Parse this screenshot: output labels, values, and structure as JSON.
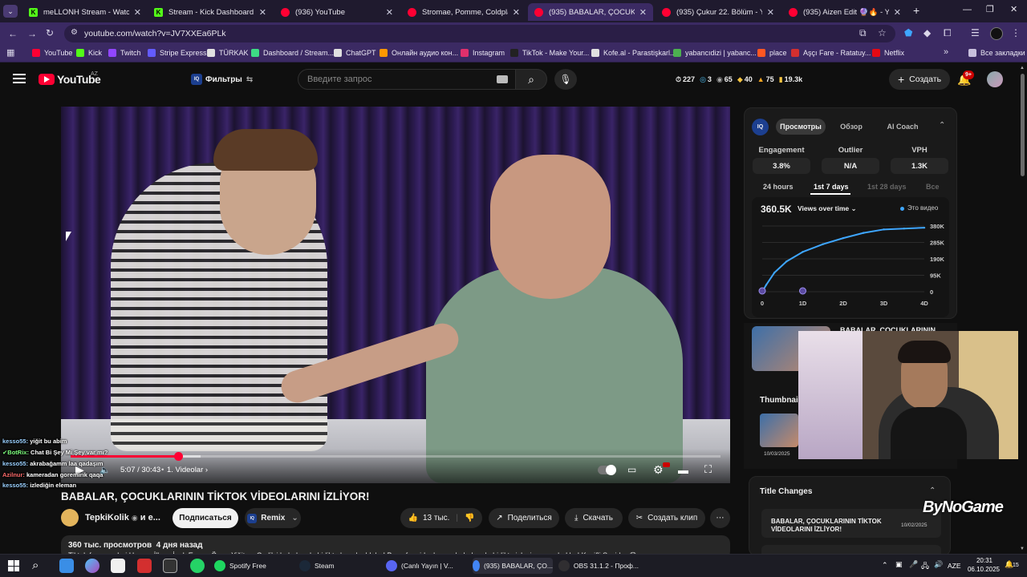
{
  "browser": {
    "tabs": [
      {
        "title": "meLLONH Stream - Watch Live",
        "icon": "kick-icon"
      },
      {
        "title": "Stream - Kick Dashboard",
        "icon": "kick-icon"
      },
      {
        "title": "(936) YouTube",
        "icon": "youtube-icon"
      },
      {
        "title": "Stromae, Pomme, Coldplay - \"M",
        "icon": "youtube-icon"
      },
      {
        "title": "(935) BABALAR, ÇOCUKLARINI",
        "icon": "youtube-icon",
        "active": true
      },
      {
        "title": "(935) Çukur 22. Bölüm - YouTub",
        "icon": "youtube-icon"
      },
      {
        "title": "(935) Aizen Edit 🔮🔥 - YouTub",
        "icon": "youtube-icon"
      }
    ],
    "url": "youtube.com/watch?v=JV7XXEa6PLk",
    "bookmarks": [
      {
        "label": "YouTube",
        "color": "#ff0033"
      },
      {
        "label": "Kick",
        "color": "#53fc18"
      },
      {
        "label": "Twitch",
        "color": "#9146ff"
      },
      {
        "label": "Stripe Express",
        "color": "#635bff"
      },
      {
        "label": "TÜRKAK",
        "color": "#e0e0e0"
      },
      {
        "label": "Dashboard / Stream...",
        "color": "#3ddc84"
      },
      {
        "label": "ChatGPT",
        "color": "#e0e0e0"
      },
      {
        "label": "Онлайн аудио кон...",
        "color": "#ff9800"
      },
      {
        "label": "Instagram",
        "color": "#e1306c"
      },
      {
        "label": "TikTok - Make Your...",
        "color": "#222222"
      },
      {
        "label": "Kofe.al - Parastişkarl...",
        "color": "#e0e0e0"
      },
      {
        "label": "yabancıdizi | yabanc...",
        "color": "#4caf50"
      },
      {
        "label": "place",
        "color": "#ff5722"
      },
      {
        "label": "Aşçı Fare - Ratatuy...",
        "color": "#d32f2f"
      },
      {
        "label": "Netflix",
        "color": "#e50914"
      }
    ],
    "all_bookmarks": "Все закладки"
  },
  "masthead": {
    "logo": "YouTube",
    "region": "AZ",
    "filters": "Фильтры",
    "search_placeholder": "Введите запрос",
    "stats": [
      "227",
      "3",
      "65",
      "40",
      "75",
      "19.3k"
    ],
    "create": "Создать",
    "notifications": "9+"
  },
  "player": {
    "time": "5:07 / 30:43",
    "chapter": "1. Videolar",
    "progress": 0.165,
    "buffered": 0.2
  },
  "chat": [
    {
      "user": "kesso55:",
      "text": "yiğit bu abim"
    },
    {
      "user": "✔BotRix:",
      "text": "Chat Bi Şey Mi Şey var mı?"
    },
    {
      "user": "kesso55:",
      "text": "akrabağamm laa qadaşım"
    },
    {
      "user": "Azilnur:",
      "text": "kameradan goremirik qaqa"
    },
    {
      "user": "kesso55:",
      "text": "izlediğin eleman"
    }
  ],
  "video": {
    "title": "BABALAR, ÇOCUKLARININ TİKTOK VİDEOLARINI İZLİYOR!",
    "channel": "TepkiKolik",
    "channel_suffix": "и е...",
    "subscribe": "Подписаться",
    "remix": "Remix",
    "likes": "13 тыс.",
    "share": "Поделиться",
    "download": "Скачать",
    "clip": "Создать клип",
    "views": "360 тыс. просмотров",
    "ago": "4 дня назад",
    "description": "Tiktok fenomenleri Hamza İlkes, İpek Ersen, Ömer Yiğit ve Cedi'si babalarıyla birlikte konuk oldular! Bu sefer videolarının babalarıyla birlikte izleyip yorumladılar! Keyifli Seyirler 😊"
  },
  "vidiq": {
    "tabs": [
      "Просмотры",
      "Обзор",
      "AI Coach"
    ],
    "metrics": [
      {
        "label": "Engagement",
        "value": "3.8%"
      },
      {
        "label": "Outlier",
        "value": "N/A"
      },
      {
        "label": "VPH",
        "value": "1.3K"
      }
    ],
    "time_tabs": [
      "24 hours",
      "1st 7 days",
      "1st 28 days",
      "Все"
    ],
    "total_views": "360.5K",
    "views_select": "Views over time",
    "legend": "Это видео",
    "thumbnail_heading": "Thumbnail",
    "thumb_date": "10/03/2025",
    "title_changes_heading": "Title Changes",
    "title_change_text": "BABALAR, ÇOCUKLARININ TİKTOK VİDEOLARINI İZLİYOR!",
    "title_change_date": "10/02/2025",
    "related_title": "BABALAR, ÇOCUKLARININ"
  },
  "chart_data": {
    "type": "line",
    "title": "",
    "x_ticks": [
      "0",
      "1D",
      "2D",
      "3D",
      "4D"
    ],
    "y_ticks": [
      "380K",
      "285K",
      "190K",
      "95K",
      "0"
    ],
    "ylim": [
      0,
      380000
    ],
    "series": [
      {
        "name": "Это видео",
        "color": "#3ea6ff",
        "x": [
          0,
          0.1,
          0.3,
          0.6,
          1.0,
          1.5,
          2.0,
          2.5,
          3.0,
          3.5,
          4.0
        ],
        "y": [
          0,
          40000,
          110000,
          175000,
          230000,
          275000,
          310000,
          340000,
          360000,
          365000,
          370000
        ]
      }
    ]
  },
  "watermark": "ByNoGame",
  "taskbar": {
    "apps": [
      {
        "label": "Spotify Free",
        "color": "#1ed760"
      },
      {
        "label": "Steam",
        "color": "#1b2838"
      },
      {
        "label": "(Canlı Yayın | V...",
        "color": "#5865f2"
      },
      {
        "label": "(935) BABALAR, ÇO...",
        "color": "#4285f4"
      },
      {
        "label": "OBS 31.1.2 - Проф...",
        "color": "#302e31"
      }
    ],
    "lang": "AZE",
    "time": "20:31",
    "date": "06.10.2025",
    "notif_count": "15"
  }
}
